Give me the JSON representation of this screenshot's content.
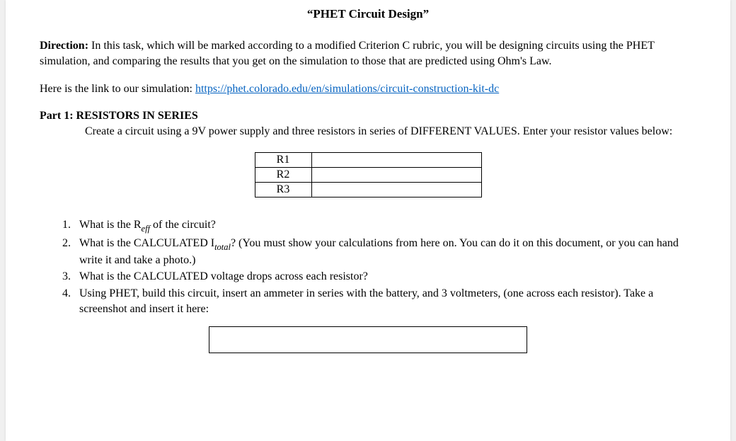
{
  "title": "“PHET Circuit Design”",
  "direction": {
    "label": "Direction:",
    "text": " In this task, which will be marked according to a modified Criterion C rubric, you will be designing circuits using the PHET simulation, and comparing the results that you get on the simulation to those that are predicted using Ohm's Law."
  },
  "link": {
    "prefix": "Here is the link to our simulation: ",
    "url": "https://phet.colorado.edu/en/simulations/circuit-construction-kit-dc"
  },
  "part1": {
    "heading": "Part 1: RESISTORS IN SERIES",
    "instructions_lead": "Create a circuit using a 9V power supply and three resistors in series of DIFFERENT VALUES. Enter your resistor values below:"
  },
  "resistor_table": {
    "rows": [
      {
        "label": "R1",
        "value": ""
      },
      {
        "label": "R2",
        "value": ""
      },
      {
        "label": "R3",
        "value": ""
      }
    ]
  },
  "questions": {
    "q1_a": "What is the R",
    "q1_sub": "eff",
    "q1_b": " of the circuit?",
    "q2_a": "What is the CALCULATED I",
    "q2_sub": "total",
    "q2_b": "? (You must show your calculations from here on. You can do it on this document, or you can hand write it and take a photo.)",
    "q3": "What is the CALCULATED voltage drops across each resistor?",
    "q4": "Using PHET, build this circuit, insert an ammeter in series with the battery, and 3 voltmeters, (one across each resistor). Take a screenshot and insert it here:"
  }
}
